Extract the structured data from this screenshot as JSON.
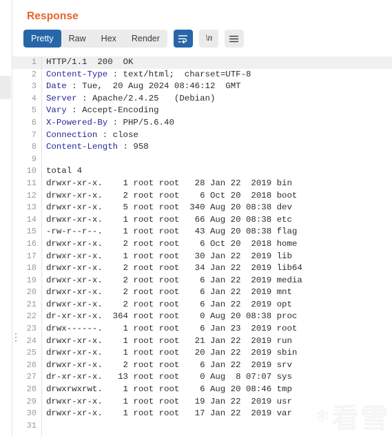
{
  "panel": {
    "title": "Response"
  },
  "toolbar": {
    "tabs": [
      {
        "label": "Pretty",
        "active": true
      },
      {
        "label": "Raw",
        "active": false
      },
      {
        "label": "Hex",
        "active": false
      },
      {
        "label": "Render",
        "active": false
      }
    ],
    "buttons": [
      {
        "name": "word-wrap-icon",
        "label": "",
        "active": true
      },
      {
        "name": "newline-icon",
        "label": "\\n",
        "active": false
      },
      {
        "name": "hamburger-menu-icon",
        "label": "",
        "active": false
      }
    ]
  },
  "editor": {
    "highlighted_line": 1,
    "lines": [
      {
        "n": 1,
        "type": "status",
        "text": "HTTP/1.1  200  OK"
      },
      {
        "n": 2,
        "type": "header",
        "name": "Content-Type",
        "sep": " : ",
        "value": "text/html;  charset=UTF-8"
      },
      {
        "n": 3,
        "type": "header",
        "name": "Date",
        "sep": " : ",
        "value": "Tue,  20 Aug 2024 08:46:12  GMT"
      },
      {
        "n": 4,
        "type": "header",
        "name": "Server",
        "sep": " : ",
        "value": "Apache/2.4.25   (Debian)"
      },
      {
        "n": 5,
        "type": "header",
        "name": "Vary",
        "sep": " : ",
        "value": "Accept-Encoding"
      },
      {
        "n": 6,
        "type": "header",
        "name": "X-Powered-By",
        "sep": " : ",
        "value": "PHP/5.6.40"
      },
      {
        "n": 7,
        "type": "header",
        "name": "Connection",
        "sep": " : ",
        "value": "close"
      },
      {
        "n": 8,
        "type": "header",
        "name": "Content-Length",
        "sep": " : ",
        "value": "958"
      },
      {
        "n": 9,
        "type": "blank",
        "text": ""
      },
      {
        "n": 10,
        "type": "body",
        "text": "total 4"
      },
      {
        "n": 11,
        "type": "body",
        "text": "drwxr-xr-x.    1 root root   28 Jan 22  2019 bin"
      },
      {
        "n": 12,
        "type": "body",
        "text": "drwxr-xr-x.    2 root root    6 Oct 20  2018 boot"
      },
      {
        "n": 13,
        "type": "body",
        "text": "drwxr-xr-x.    5 root root  340 Aug 20 08:38 dev"
      },
      {
        "n": 14,
        "type": "body",
        "text": "drwxr-xr-x.    1 root root   66 Aug 20 08:38 etc"
      },
      {
        "n": 15,
        "type": "body",
        "text": "-rw-r--r--.    1 root root   43 Aug 20 08:38 flag"
      },
      {
        "n": 16,
        "type": "body",
        "text": "drwxr-xr-x.    2 root root    6 Oct 20  2018 home"
      },
      {
        "n": 17,
        "type": "body",
        "text": "drwxr-xr-x.    1 root root   30 Jan 22  2019 lib"
      },
      {
        "n": 18,
        "type": "body",
        "text": "drwxr-xr-x.    2 root root   34 Jan 22  2019 lib64"
      },
      {
        "n": 19,
        "type": "body",
        "text": "drwxr-xr-x.    2 root root    6 Jan 22  2019 media"
      },
      {
        "n": 20,
        "type": "body",
        "text": "drwxr-xr-x.    2 root root    6 Jan 22  2019 mnt"
      },
      {
        "n": 21,
        "type": "body",
        "text": "drwxr-xr-x.    2 root root    6 Jan 22  2019 opt"
      },
      {
        "n": 22,
        "type": "body",
        "text": "dr-xr-xr-x.  364 root root    0 Aug 20 08:38 proc"
      },
      {
        "n": 23,
        "type": "body",
        "text": "drwx------.    1 root root    6 Jan 23  2019 root"
      },
      {
        "n": 24,
        "type": "body",
        "text": "drwxr-xr-x.    1 root root   21 Jan 22  2019 run"
      },
      {
        "n": 25,
        "type": "body",
        "text": "drwxr-xr-x.    1 root root   20 Jan 22  2019 sbin"
      },
      {
        "n": 26,
        "type": "body",
        "text": "drwxr-xr-x.    2 root root    6 Jan 22  2019 srv"
      },
      {
        "n": 27,
        "type": "body",
        "text": "dr-xr-xr-x.   13 root root    0 Aug  8 07:07 sys"
      },
      {
        "n": 28,
        "type": "body",
        "text": "drwxrwxrwt.    1 root root    6 Aug 20 08:46 tmp"
      },
      {
        "n": 29,
        "type": "body",
        "text": "drwxr-xr-x.    1 root root   19 Jan 22  2019 usr"
      },
      {
        "n": 30,
        "type": "body",
        "text": "drwxr-xr-x.    1 root root   17 Jan 22  2019 var"
      },
      {
        "n": 31,
        "type": "blank",
        "text": ""
      }
    ]
  },
  "watermark": {
    "text": "看雪"
  },
  "colors": {
    "accent_orange": "#e8622c",
    "tab_active_blue": "#2766a8",
    "header_name_blue": "#26269c",
    "body_text": "#2c2c2c",
    "gutter_text": "#9b9b9b",
    "line_highlight": "#f0f0f0",
    "toolbar_bg": "#ebebeb"
  }
}
